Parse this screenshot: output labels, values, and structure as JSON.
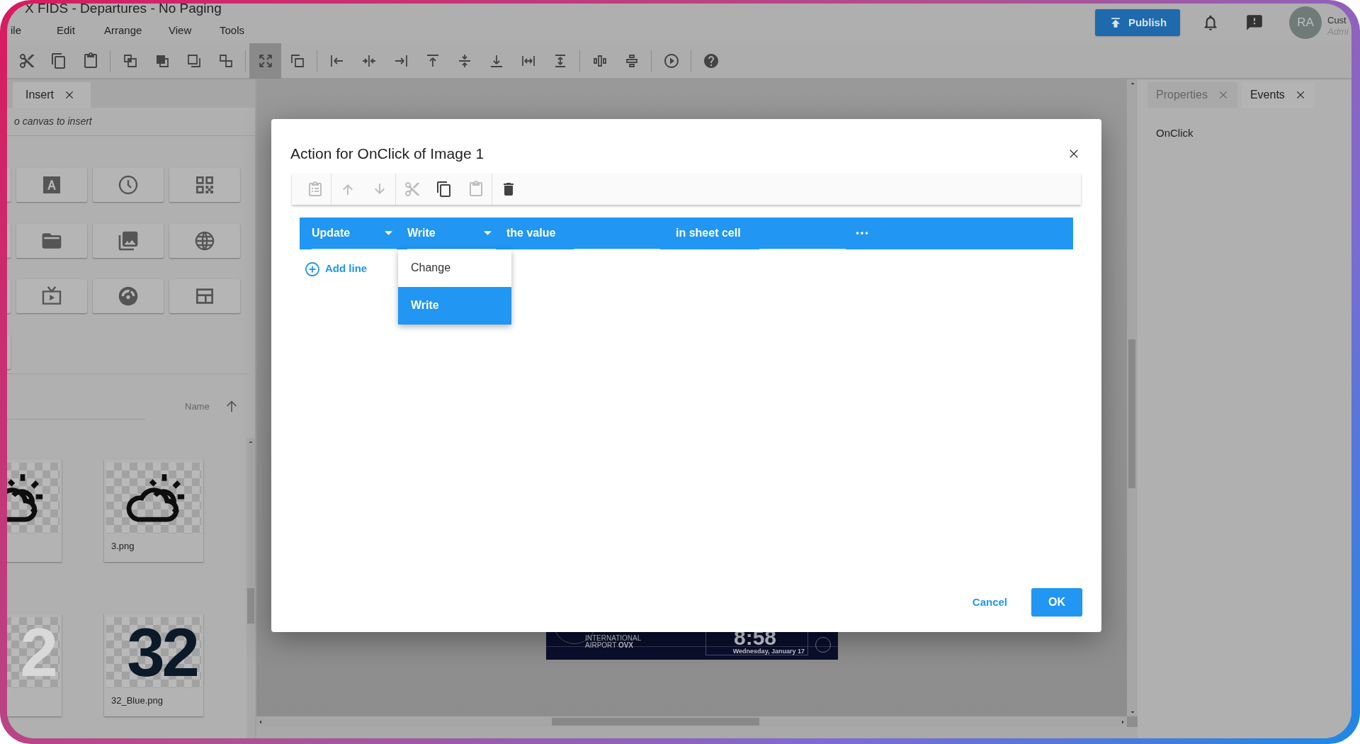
{
  "app": {
    "title": "X FIDS - Departures - No Paging",
    "menu": [
      "ile",
      "Edit",
      "Arrange",
      "View",
      "Tools"
    ]
  },
  "header": {
    "publish": "Publish",
    "avatar": "RA",
    "user_lines": [
      "Cust",
      "Admi"
    ]
  },
  "toolbar": [
    {
      "selected": false
    },
    {
      "selected": false
    },
    {
      "selected": false
    },
    {
      "selected": false
    },
    {
      "selected": false
    },
    {
      "selected": false
    },
    {
      "selected": false
    },
    {
      "selected": true
    },
    {
      "selected": false
    },
    {
      "selected": false
    },
    {
      "selected": false
    },
    {
      "selected": false
    },
    {
      "selected": false
    },
    {
      "selected": false
    },
    {
      "selected": false
    },
    {
      "selected": false
    },
    {
      "selected": false
    },
    {
      "selected": false
    },
    {
      "selected": false
    },
    {
      "selected": false
    },
    {
      "selected": false
    }
  ],
  "left_panel": {
    "tabs": [
      {
        "label": "Insert",
        "selected": true
      }
    ],
    "hint": "o canvas to insert",
    "sort": "Name",
    "files": [
      {
        "kind": "weather"
      },
      {
        "kind": "weather",
        "label": "3.png"
      },
      {
        "kind": "number",
        "glyph": "2",
        "color": "#d9d9d9"
      },
      {
        "kind": "number",
        "glyph": "32",
        "color": "#0b1a28",
        "label": "32_Blue.png"
      }
    ]
  },
  "canvas": {
    "lines": [
      "INTERNATIONAL",
      "AIRPORT **OVX**"
    ],
    "time": "8:58",
    "date": "Wednesday, January 17"
  },
  "right_panel": {
    "tabs": [
      {
        "label": "Properties",
        "selected": false
      },
      {
        "label": "Events",
        "selected": true
      }
    ],
    "events": [
      "OnClick"
    ]
  },
  "dialog": {
    "title": "Action for OnClick of Image 1",
    "toolbar": [
      {
        "disabled": true
      },
      {
        "disabled": true
      },
      {
        "disabled": true
      },
      {
        "disabled": true
      },
      {
        "disabled": false
      },
      {
        "disabled": true
      },
      {
        "disabled": false
      }
    ],
    "action": {
      "verb": "Update",
      "mode": "Write",
      "value_label": "the value",
      "cell_label": "in sheet cell"
    },
    "dropdown": [
      {
        "label": "Change",
        "selected": false
      },
      {
        "label": "Write",
        "selected": true
      }
    ],
    "add_line": "Add line",
    "cancel": "Cancel",
    "ok": "OK"
  }
}
